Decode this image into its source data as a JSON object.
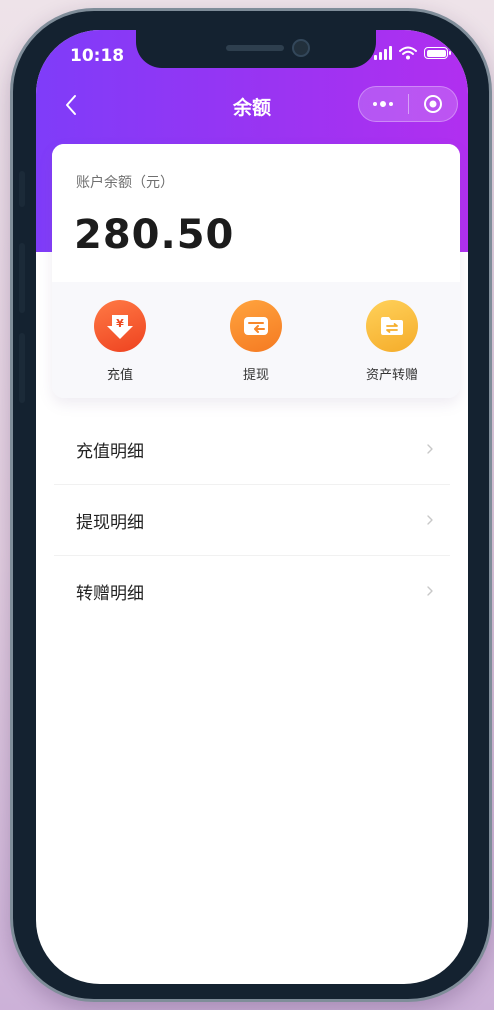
{
  "status_bar": {
    "time": "10:18",
    "signal_icon": "signal-icon",
    "wifi_icon": "wifi-icon",
    "battery_icon": "battery-icon"
  },
  "navbar": {
    "title": "余额",
    "back_icon": "chevron-left-icon",
    "more_icon": "more-dots-icon",
    "close_icon": "miniapp-close-icon"
  },
  "balance": {
    "label": "账户余额（元）",
    "amount": "280.50"
  },
  "actions": [
    {
      "label": "充值",
      "icon": "yuan-download-icon",
      "color": "#f2542d"
    },
    {
      "label": "提现",
      "icon": "wallet-icon",
      "color": "#f78a2a"
    },
    {
      "label": "资产转赠",
      "icon": "folder-transfer-icon",
      "color": "#f6b93b"
    }
  ],
  "menu": [
    {
      "label": "充值明细"
    },
    {
      "label": "提现明细"
    },
    {
      "label": "转赠明细"
    }
  ],
  "colors": {
    "header_start": "#7f3cf9",
    "header_end": "#b12ff0",
    "background": "#ffffff"
  }
}
